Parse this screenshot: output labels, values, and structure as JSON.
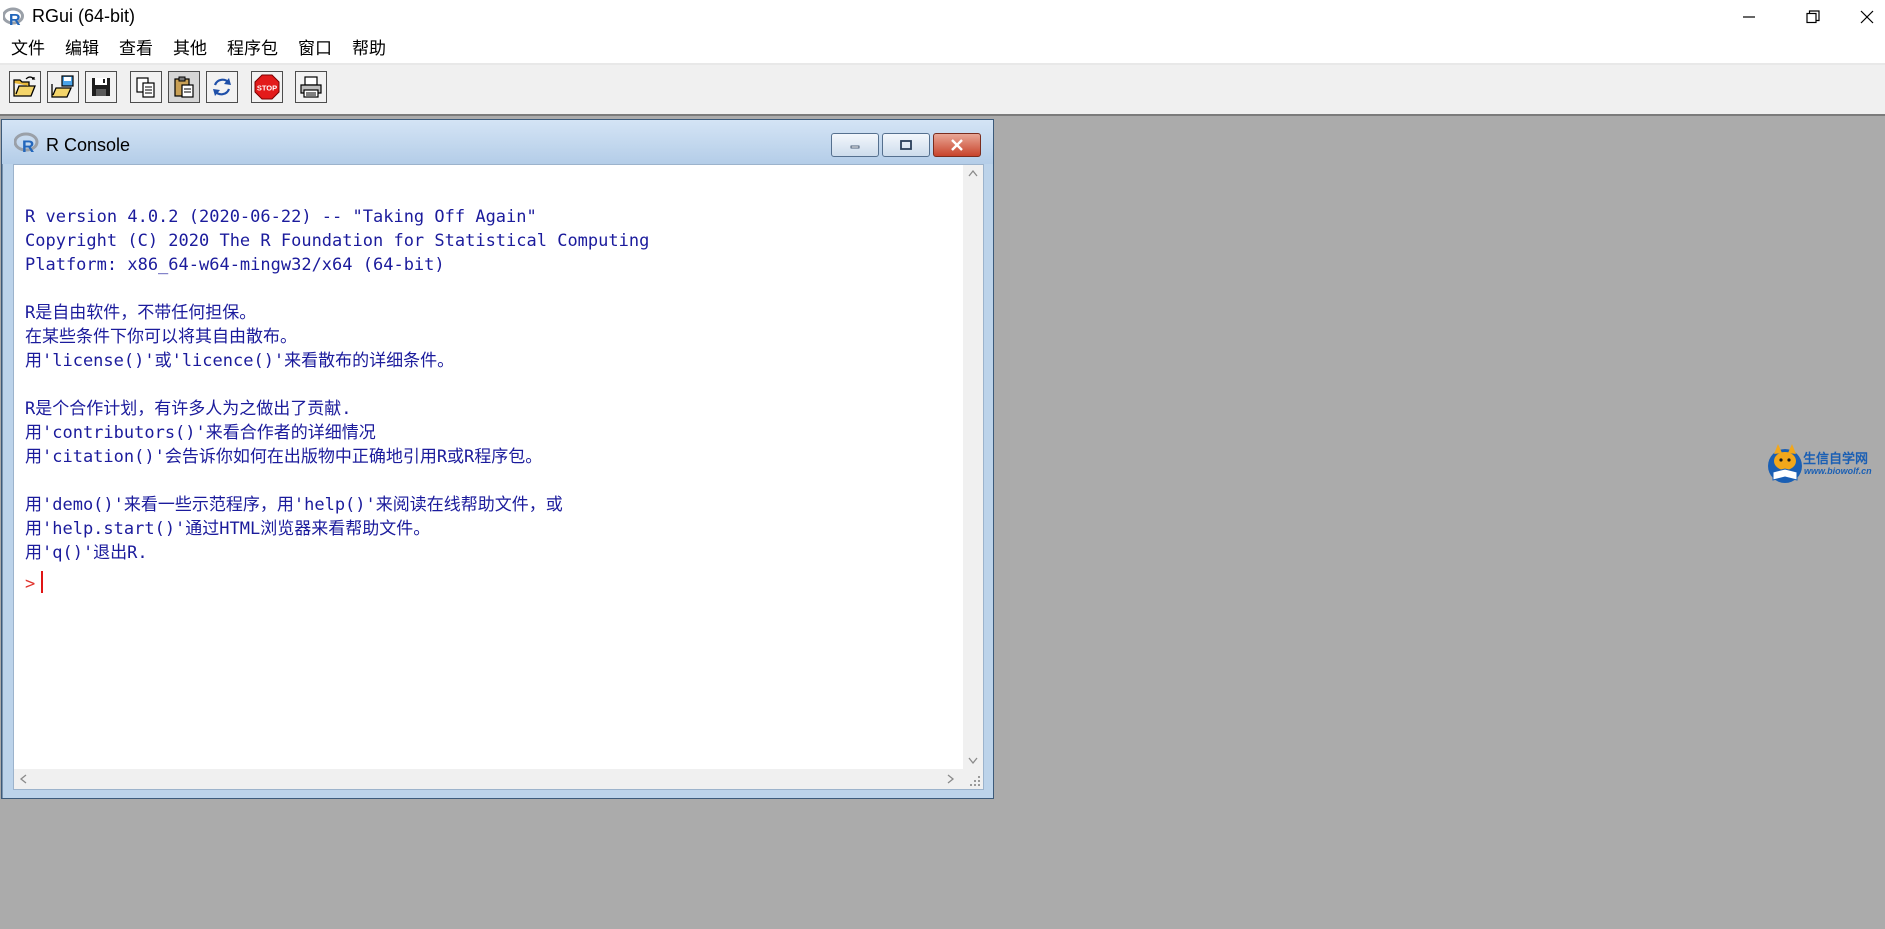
{
  "app": {
    "title": "RGui (64-bit)"
  },
  "menu": {
    "items": [
      "文件",
      "编辑",
      "查看",
      "其他",
      "程序包",
      "窗口",
      "帮助"
    ]
  },
  "toolbar": {
    "buttons": [
      {
        "name": "open-script-icon"
      },
      {
        "name": "load-workspace-icon"
      },
      {
        "name": "save-workspace-icon"
      },
      {
        "name": "copy-icon"
      },
      {
        "name": "paste-icon"
      },
      {
        "name": "copy-paste-icon"
      },
      {
        "name": "stop-icon",
        "label": "STOP"
      },
      {
        "name": "print-icon"
      }
    ]
  },
  "console": {
    "title": "R Console",
    "lines": [
      "R version 4.0.2 (2020-06-22) -- \"Taking Off Again\"",
      "Copyright (C) 2020 The R Foundation for Statistical Computing",
      "Platform: x86_64-w64-mingw32/x64 (64-bit)",
      "",
      "R是自由软件，不带任何担保。",
      "在某些条件下你可以将其自由散布。",
      "用'license()'或'licence()'来看散布的详细条件。",
      "",
      "R是个合作计划，有许多人为之做出了贡献.",
      "用'contributors()'来看合作者的详细情况",
      "用'citation()'会告诉你如何在出版物中正确地引用R或R程序包。",
      "",
      "用'demo()'来看一些示范程序，用'help()'来阅读在线帮助文件，或",
      "用'help.start()'通过HTML浏览器来看帮助文件。",
      "用'q()'退出R."
    ],
    "prompt": ">"
  },
  "watermark": {
    "line1": "生信自学网",
    "line2": "www.biowolf.cn"
  },
  "colors": {
    "console_text": "#1b1b9c",
    "prompt": "#e0322c",
    "mdi_background": "#ababab"
  }
}
